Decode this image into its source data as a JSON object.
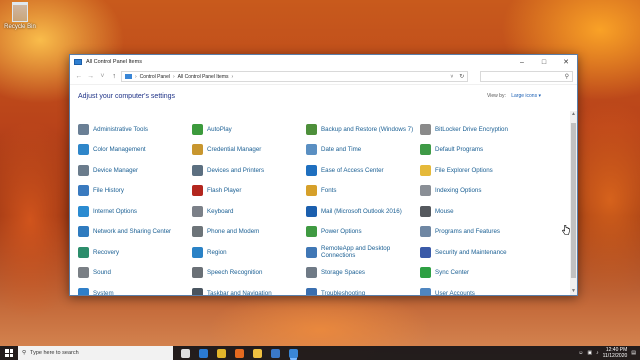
{
  "desktop": {
    "recycle_bin_label": "Recycle Bin"
  },
  "window": {
    "title": "All Control Panel Items",
    "minimize_icon": "minimize-icon",
    "maximize_icon": "maximize-icon",
    "close_icon": "close-icon"
  },
  "navigation": {
    "breadcrumb": [
      "Control Panel",
      "All Control Panel Items"
    ],
    "search_placeholder": ""
  },
  "header": {
    "heading": "Adjust your computer's settings",
    "view_by_label": "View by:",
    "view_by_value": "Large icons"
  },
  "items": [
    {
      "label": "Administrative Tools",
      "icon": "admin-tools-icon",
      "color": "#6a7f95"
    },
    {
      "label": "AutoPlay",
      "icon": "autoplay-icon",
      "color": "#3c9a3c"
    },
    {
      "label": "Backup and Restore (Windows 7)",
      "icon": "backup-icon",
      "color": "#4d8f3a"
    },
    {
      "label": "BitLocker Drive Encryption",
      "icon": "bitlocker-icon",
      "color": "#8a8a8a"
    },
    {
      "label": "Color Management",
      "icon": "color-management-icon",
      "color": "#2f86c9"
    },
    {
      "label": "Credential Manager",
      "icon": "credential-manager-icon",
      "color": "#c8962e"
    },
    {
      "label": "Date and Time",
      "icon": "date-time-icon",
      "color": "#5a8fc2"
    },
    {
      "label": "Default Programs",
      "icon": "default-programs-icon",
      "color": "#3e9a46"
    },
    {
      "label": "Device Manager",
      "icon": "device-manager-icon",
      "color": "#6b7c8c"
    },
    {
      "label": "Devices and Printers",
      "icon": "devices-printers-icon",
      "color": "#5c6f80"
    },
    {
      "label": "Ease of Access Center",
      "icon": "ease-of-access-icon",
      "color": "#1f6fbf"
    },
    {
      "label": "File Explorer Options",
      "icon": "file-explorer-options-icon",
      "color": "#e5b93a"
    },
    {
      "label": "File History",
      "icon": "file-history-icon",
      "color": "#3a7abf"
    },
    {
      "label": "Flash Player",
      "icon": "flash-player-icon",
      "color": "#b3261e"
    },
    {
      "label": "Fonts",
      "icon": "fonts-icon",
      "color": "#d6a02a"
    },
    {
      "label": "Indexing Options",
      "icon": "indexing-options-icon",
      "color": "#8a8f96"
    },
    {
      "label": "Internet Options",
      "icon": "internet-options-icon",
      "color": "#2b8bd1"
    },
    {
      "label": "Keyboard",
      "icon": "keyboard-icon",
      "color": "#7b8088"
    },
    {
      "label": "Mail (Microsoft Outlook 2016)",
      "icon": "mail-icon",
      "color": "#1b5fae"
    },
    {
      "label": "Mouse",
      "icon": "mouse-icon",
      "color": "#55595e"
    },
    {
      "label": "Network and Sharing Center",
      "icon": "network-sharing-icon",
      "color": "#2f7bbf"
    },
    {
      "label": "Phone and Modem",
      "icon": "phone-modem-icon",
      "color": "#6d7479"
    },
    {
      "label": "Power Options",
      "icon": "power-options-icon",
      "color": "#3f9a42"
    },
    {
      "label": "Programs and Features",
      "icon": "programs-features-icon",
      "color": "#6f87a3"
    },
    {
      "label": "Recovery",
      "icon": "recovery-icon",
      "color": "#2c8d6b"
    },
    {
      "label": "Region",
      "icon": "region-icon",
      "color": "#2a82c6"
    },
    {
      "label": "RemoteApp and Desktop Connections",
      "icon": "remoteapp-icon",
      "color": "#4077b5"
    },
    {
      "label": "Security and Maintenance",
      "icon": "security-maintenance-icon",
      "color": "#3a5aa8"
    },
    {
      "label": "Sound",
      "icon": "sound-icon",
      "color": "#7a7f85"
    },
    {
      "label": "Speech Recognition",
      "icon": "speech-recognition-icon",
      "color": "#6a7076"
    },
    {
      "label": "Storage Spaces",
      "icon": "storage-spaces-icon",
      "color": "#6f7a86"
    },
    {
      "label": "Sync Center",
      "icon": "sync-center-icon",
      "color": "#2ea043"
    },
    {
      "label": "System",
      "icon": "system-icon",
      "color": "#2f7fc8"
    },
    {
      "label": "Taskbar and Navigation",
      "icon": "taskbar-navigation-icon",
      "color": "#4a5560"
    },
    {
      "label": "Troubleshooting",
      "icon": "troubleshooting-icon",
      "color": "#3a6fb0"
    },
    {
      "label": "User Accounts",
      "icon": "user-accounts-icon",
      "color": "#4f86c0"
    }
  ],
  "taskbar": {
    "search_text": "Type here to search",
    "pinned": [
      {
        "icon": "task-view-icon",
        "color": "#e0e0e0"
      },
      {
        "icon": "edge-icon",
        "color": "#2b7bd3"
      },
      {
        "icon": "chrome-icon",
        "color": "#e3b52a"
      },
      {
        "icon": "firefox-icon",
        "color": "#e66a1f"
      },
      {
        "icon": "file-explorer-icon",
        "color": "#f0c040"
      },
      {
        "icon": "store-icon",
        "color": "#3a78c8"
      },
      {
        "icon": "control-panel-icon",
        "color": "#3a86d6"
      }
    ],
    "time": "12:40 PM",
    "date": "11/12/2020"
  }
}
